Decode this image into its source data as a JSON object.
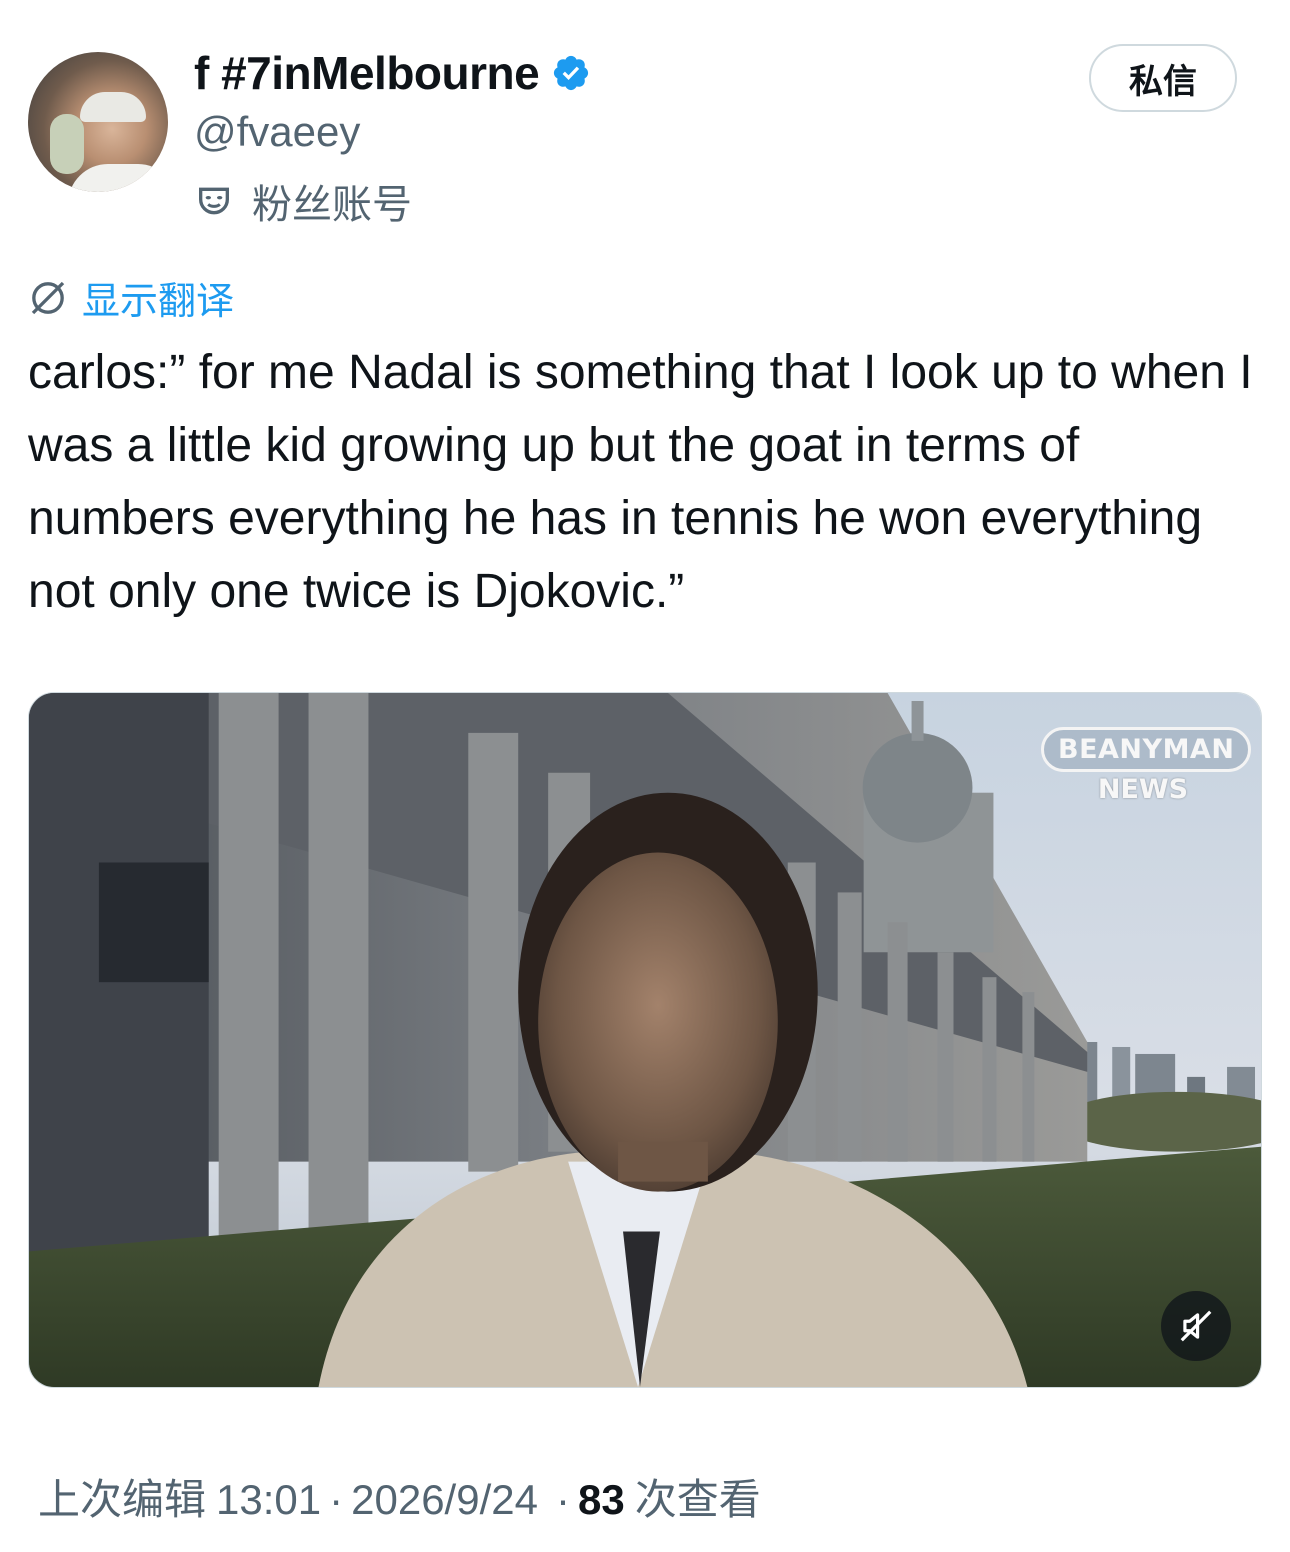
{
  "user": {
    "display_name": "f #7inMelbourne",
    "handle": "@fvaeey",
    "account_label": "粉丝账号",
    "verified_icon": "verified-badge-icon",
    "verified_color": "#1d9bf0"
  },
  "actions": {
    "dm_label": "私信"
  },
  "translate": {
    "label": "显示翻译",
    "icon": "globe-icon",
    "color": "#1d9bf0"
  },
  "tweet": {
    "text": "carlos:” for me Nadal is something that I look up to when I was a little kid growing up but the goat in terms of numbers everything he has in tennis he won everything not only one twice is Djokovic.”"
  },
  "media": {
    "watermark_line1": "BEANYMAN",
    "watermark_line2": "NEWS",
    "mute_icon": "speaker-muted-icon"
  },
  "meta": {
    "edited_prefix": "上次编辑",
    "time": "13:01",
    "separator": "·",
    "date": "2026/9/24",
    "separator2": "·",
    "views_count": "83",
    "views_label": "次查看"
  },
  "colors": {
    "text_primary": "#0f1419",
    "text_secondary": "#536471",
    "link": "#1d9bf0",
    "border": "#cfd9de"
  }
}
